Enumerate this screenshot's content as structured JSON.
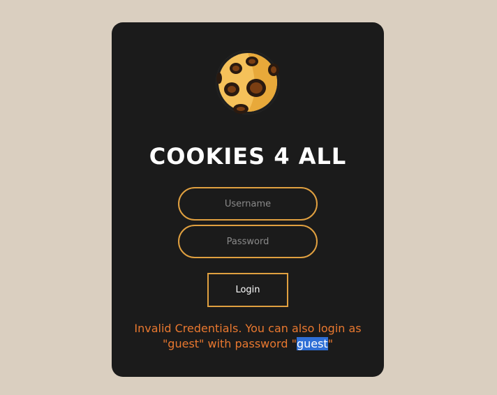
{
  "app": {
    "title": "COOKIES 4 ALL",
    "logo_icon": "cookie-icon"
  },
  "form": {
    "username_placeholder": "Username",
    "password_placeholder": "Password",
    "username_value": "",
    "password_value": "",
    "login_label": "Login"
  },
  "message": {
    "text_before": "Invalid Credentials. You can also login as \"guest\" with password \"",
    "highlighted": "guest",
    "text_after": "\""
  },
  "colors": {
    "background": "#dacfc0",
    "card": "#1b1b1b",
    "accent": "#e0a040",
    "error": "#e9782f",
    "selection": "#2f6fd6"
  }
}
